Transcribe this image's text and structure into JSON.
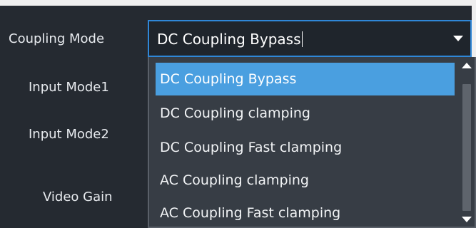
{
  "labels": {
    "coupling_mode": "Coupling Mode",
    "input_mode1": "Input Mode1",
    "input_mode2": "Input Mode2",
    "video_gain": "Video Gain"
  },
  "coupling_select": {
    "value": "DC Coupling Bypass",
    "expanded": true,
    "arrow_icon": "triangle-down-icon",
    "options": [
      {
        "label": "DC Coupling Bypass",
        "selected": true
      },
      {
        "label": "DC Coupling clamping",
        "selected": false
      },
      {
        "label": "DC Coupling Fast clamping",
        "selected": false
      },
      {
        "label": "AC Coupling clamping",
        "selected": false
      },
      {
        "label": "AC Coupling Fast clamping",
        "selected": false
      }
    ]
  },
  "colors": {
    "panel_bg": "#252a31",
    "select_border": "#2f87d8",
    "dropdown_bg": "#373d45",
    "selected_option_bg": "#4a9fe0",
    "text": "#e8ebef"
  }
}
